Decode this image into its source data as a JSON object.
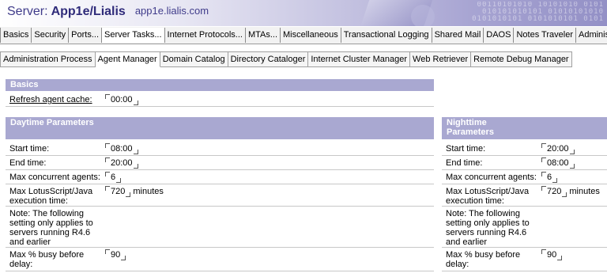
{
  "banner": {
    "server_prefix": "Server:",
    "server_name": "App1e/Lialis",
    "host": "app1e.lialis.com",
    "binary_decor": "00110101010 10101010 0101\n010101010101 01010101010\n 0101010101 0101010101 0101"
  },
  "tabs": [
    {
      "label": "Basics",
      "active": false
    },
    {
      "label": "Security",
      "active": false
    },
    {
      "label": "Ports...",
      "active": false
    },
    {
      "label": "Server Tasks...",
      "active": true
    },
    {
      "label": "Internet Protocols...",
      "active": false
    },
    {
      "label": "MTAs...",
      "active": false
    },
    {
      "label": "Miscellaneous",
      "active": false
    },
    {
      "label": "Transactional Logging",
      "active": false
    },
    {
      "label": "Shared Mail",
      "active": false
    },
    {
      "label": "DAOS",
      "active": false
    },
    {
      "label": "Notes Traveler",
      "active": false
    },
    {
      "label": "Administ",
      "active": false
    }
  ],
  "subtabs": [
    {
      "label": "Administration Process",
      "active": false
    },
    {
      "label": "Agent Manager",
      "active": true
    },
    {
      "label": "Domain Catalog",
      "active": false
    },
    {
      "label": "Directory Cataloger",
      "active": false
    },
    {
      "label": "Internet Cluster Manager",
      "active": false
    },
    {
      "label": "Web Retriever",
      "active": false
    },
    {
      "label": "Remote Debug Manager",
      "active": false
    }
  ],
  "basics": {
    "heading": "Basics",
    "refresh_label": "Refresh agent cache:",
    "refresh_value": "00:00"
  },
  "daytime": {
    "heading": "Daytime Parameters",
    "start_label": "Start time:",
    "start_value": "08:00",
    "end_label": "End time:",
    "end_value": "20:00",
    "max_agents_label": "Max concurrent agents:",
    "max_agents_value": "6",
    "max_exec_label": "Max LotusScript/Java execution time:",
    "max_exec_value": "720",
    "max_exec_unit": "minutes",
    "note": "Note: The following setting only applies to servers running R4.6 and earlier",
    "busy_label": "Max % busy before delay:",
    "busy_value": "90"
  },
  "nighttime": {
    "heading": "Nighttime Parameters",
    "start_label": "Start time:",
    "start_value": "20:00",
    "end_label": "End time:",
    "end_value": "08:00",
    "max_agents_label": "Max concurrent agents:",
    "max_agents_value": "6",
    "max_exec_label": "Max LotusScript/Java execution time:",
    "max_exec_value": "720",
    "max_exec_unit": "minutes",
    "note": "Note: The following setting only applies to servers running R4.6 and earlier",
    "busy_label": "Max % busy before delay:",
    "busy_value": "90"
  }
}
